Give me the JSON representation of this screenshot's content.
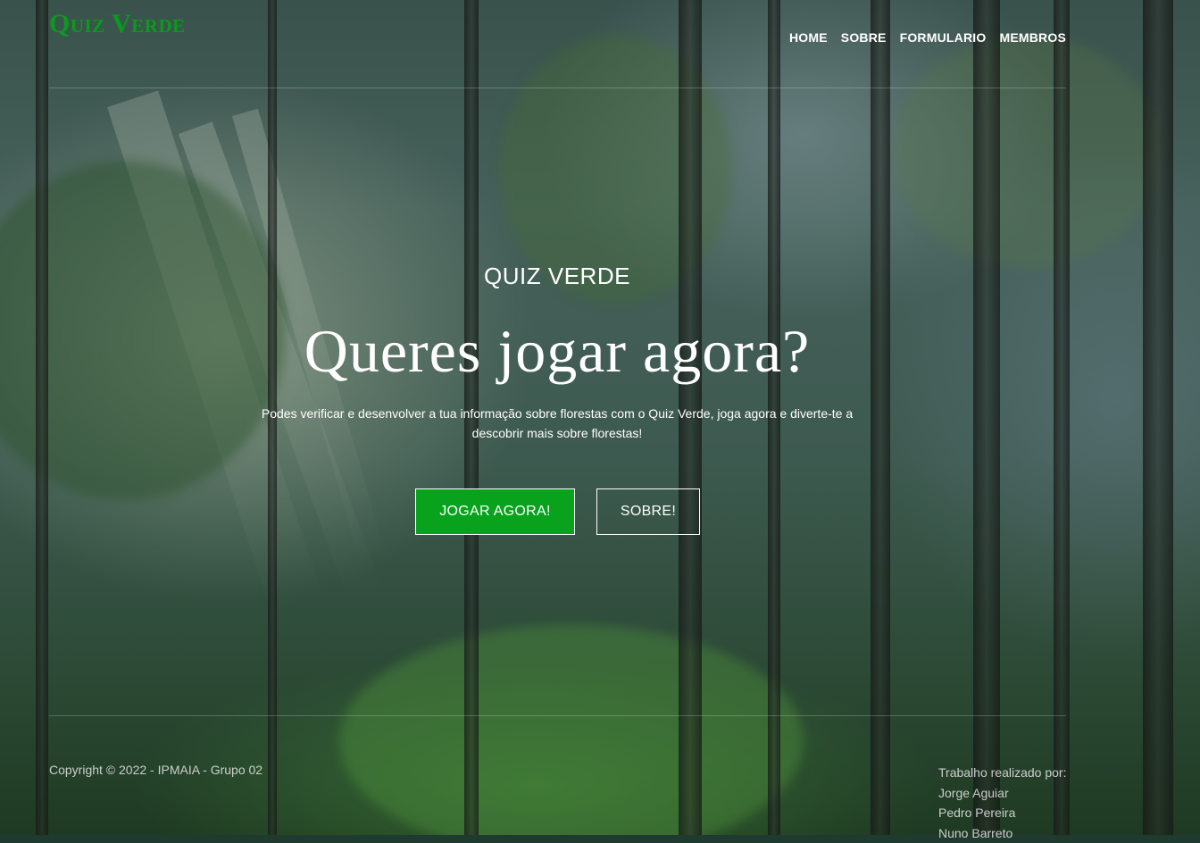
{
  "brand": {
    "name": "Quiz Verde",
    "color": "#0a9a1e"
  },
  "nav": {
    "items": [
      "HOME",
      "SOBRE",
      "FORMULARIO",
      "MEMBROS"
    ]
  },
  "hero": {
    "eyebrow": "QUIZ VERDE",
    "headline": "Queres jogar agora?",
    "description": "Podes verificar e desenvolver a tua informação sobre florestas com o Quiz Verde, joga agora e diverte-te a descobrir mais sobre florestas!",
    "play_button": "JOGAR AGORA!",
    "about_button": "SOBRE!",
    "play_button_color": "#08a21d"
  },
  "footer": {
    "copyright": "Copyright © 2022 - IPMAIA - Grupo 02",
    "credits_label": "Trabalho realizado por:",
    "members": [
      "Jorge Aguiar",
      "Pedro Pereira",
      "Nuno Barreto"
    ]
  }
}
